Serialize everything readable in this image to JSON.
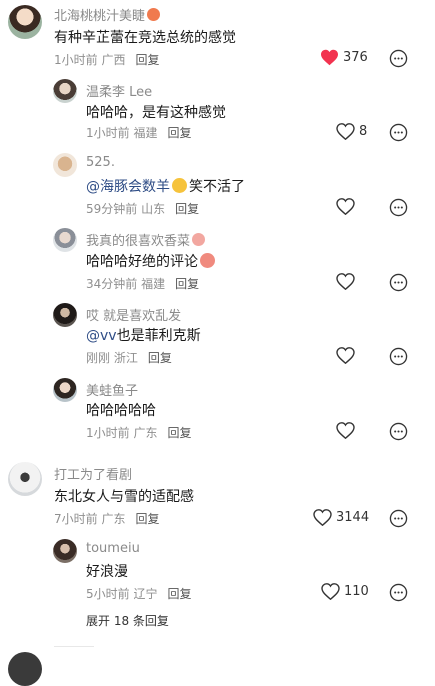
{
  "comments": [
    {
      "name": "北海桃桃汁美睫",
      "text": "有种辛芷蕾在竞选总统的感觉",
      "time": "1小时前",
      "location": "广西",
      "reply": "回复",
      "likes": "376",
      "liked": true
    },
    {
      "name": "温柔李 Lee",
      "text": "哈哈哈，是有这种感觉",
      "time": "1小时前",
      "location": "福建",
      "reply": "回复",
      "likes": "8",
      "liked": false
    },
    {
      "name": "525.",
      "mention": "@海豚会数羊",
      "text": "笑不活了",
      "time": "59分钟前",
      "location": "山东",
      "reply": "回复",
      "likes": "",
      "liked": false
    },
    {
      "name": "我真的很喜欢香菜",
      "text": "哈哈哈好绝的评论",
      "time": "34分钟前",
      "location": "福建",
      "reply": "回复",
      "likes": "",
      "liked": false
    },
    {
      "name": "哎 就是喜欢乱发",
      "mention": "@vv",
      "text": "也是菲利克斯",
      "time": "刚刚",
      "location": "浙江",
      "reply": "回复",
      "likes": "",
      "liked": false
    },
    {
      "name": "美蛙鱼子",
      "text": "哈哈哈哈哈",
      "time": "1小时前",
      "location": "广东",
      "reply": "回复",
      "likes": "",
      "liked": false
    },
    {
      "name": "打工为了看剧",
      "text": "东北女人与雪的适配感",
      "time": "7小时前",
      "location": "广东",
      "reply": "回复",
      "likes": "3144",
      "liked": false
    },
    {
      "name": "toumeiu",
      "text": "好浪漫",
      "time": "5小时前",
      "location": "辽宁",
      "reply": "回复",
      "likes": "110",
      "liked": false
    }
  ],
  "expand_replies": "展开 18 条回复",
  "colors": {
    "liked": "#f2334f",
    "mention": "#2f4d86"
  },
  "icons": {
    "like": "heart-icon",
    "more": "more-options-icon"
  }
}
